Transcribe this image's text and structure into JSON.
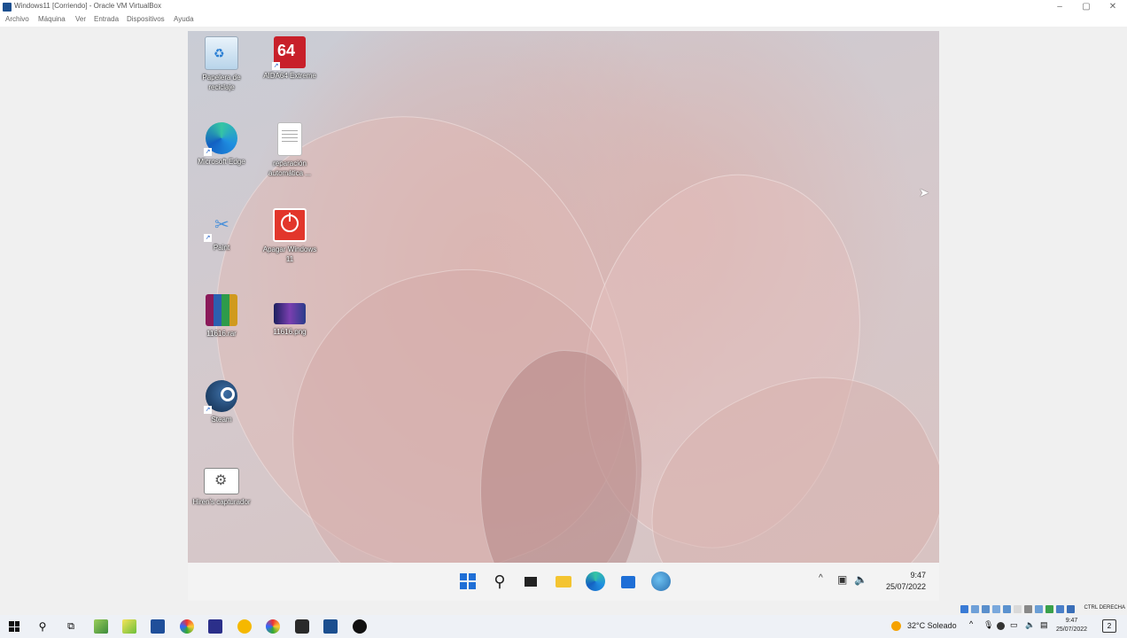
{
  "host_window": {
    "title": "Windows11 [Corriendo] - Oracle VM VirtualBox",
    "menu": [
      "Archivo",
      "Máquina",
      "Ver",
      "Entrada",
      "Dispositivos",
      "Ayuda"
    ],
    "controls": {
      "minimize": "–",
      "restore": "▢",
      "close": "✕"
    }
  },
  "desktop_icons": [
    {
      "label": "Papelera de reciclaje",
      "icon": "recycle-bin-icon"
    },
    {
      "label": "AIDA64 Extreme",
      "icon": "aida64-icon",
      "badge": "64"
    },
    {
      "label": "Microsoft Edge",
      "icon": "edge-icon"
    },
    {
      "label": "reparación automática ...",
      "icon": "document-icon"
    },
    {
      "label": "Paint",
      "icon": "paint-icon"
    },
    {
      "label": "Apagar Windows 11",
      "icon": "power-icon"
    },
    {
      "label": "11616.rar",
      "icon": "winrar-icon"
    },
    {
      "label": "11616.png",
      "icon": "image-icon"
    },
    {
      "label": "Steam",
      "icon": "steam-icon"
    },
    {
      "label": "Hiren's capturador",
      "icon": "settings-app-icon"
    }
  ],
  "vm_taskbar": {
    "apps": [
      "start-icon",
      "search-icon",
      "task-view-icon",
      "file-explorer-icon",
      "edge-icon",
      "store-icon",
      "network-app-icon"
    ],
    "tray": {
      "chevron": "^",
      "network": "▣",
      "volume": "🔈"
    },
    "time": "9:47",
    "date": "25/07/2022"
  },
  "vbox_status": {
    "host_key": "CTRL DERECHA"
  },
  "host_taskbar": {
    "weather": "32°C  Soleado",
    "time": "9:47",
    "date": "25/07/2022",
    "notifications": "2"
  },
  "colors": {
    "windows_blue": "#1f6fd6",
    "aida_red": "#c8202a",
    "power_red": "#e2362b",
    "folder_yellow": "#f4c430"
  }
}
